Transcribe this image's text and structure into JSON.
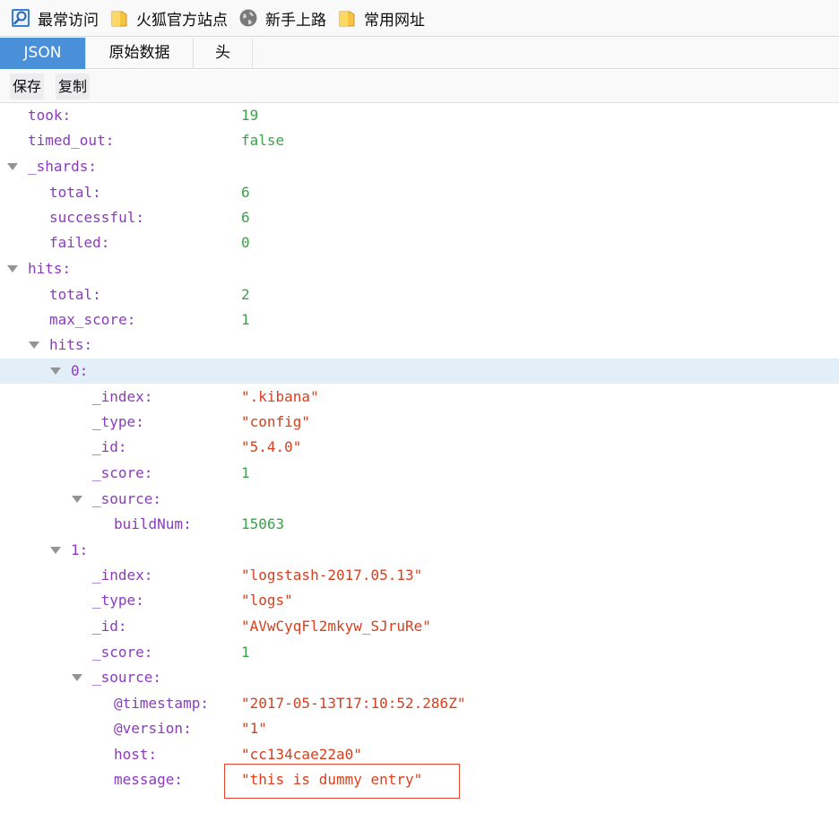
{
  "bookmarks": [
    {
      "label": "最常访问",
      "icon": "most-visited-icon"
    },
    {
      "label": "火狐官方站点",
      "icon": "folder-icon"
    },
    {
      "label": "新手上路",
      "icon": "globe-icon"
    },
    {
      "label": "常用网址",
      "icon": "folder-icon"
    }
  ],
  "tabs": [
    {
      "label": "JSON",
      "selected": true
    },
    {
      "label": "原始数据",
      "selected": false
    },
    {
      "label": "头",
      "selected": false
    }
  ],
  "actions": {
    "save": "保存",
    "copy": "复制"
  },
  "colors": {
    "selected_tab": "#4a90d9",
    "key": "#8b3bbe",
    "number": "#3ca24a",
    "string": "#d7401e",
    "selected_row": "#e3eff8",
    "highlight_box": "#e8442c"
  },
  "rows": [
    {
      "key": "took:",
      "value": "19",
      "type": "num"
    },
    {
      "key": "timed_out:",
      "value": "false",
      "type": "bool"
    },
    {
      "key": "_shards:",
      "expanded": true
    },
    {
      "key": "total:",
      "value": "6",
      "type": "num"
    },
    {
      "key": "successful:",
      "value": "6",
      "type": "num"
    },
    {
      "key": "failed:",
      "value": "0",
      "type": "num"
    },
    {
      "key": "hits:",
      "expanded": true
    },
    {
      "key": "total:",
      "value": "2",
      "type": "num"
    },
    {
      "key": "max_score:",
      "value": "1",
      "type": "num"
    },
    {
      "key": "hits:",
      "expanded": true
    },
    {
      "key": "0:",
      "expanded": true,
      "selected": true
    },
    {
      "key": "_index:",
      "value": "\".kibana\"",
      "type": "str"
    },
    {
      "key": "_type:",
      "value": "\"config\"",
      "type": "str"
    },
    {
      "key": "_id:",
      "value": "\"5.4.0\"",
      "type": "str"
    },
    {
      "key": "_score:",
      "value": "1",
      "type": "num"
    },
    {
      "key": "_source:",
      "expanded": true
    },
    {
      "key": "buildNum:",
      "value": "15063",
      "type": "num"
    },
    {
      "key": "1:",
      "expanded": true
    },
    {
      "key": "_index:",
      "value": "\"logstash-2017.05.13\"",
      "type": "str"
    },
    {
      "key": "_type:",
      "value": "\"logs\"",
      "type": "str"
    },
    {
      "key": "_id:",
      "value": "\"AVwCyqFl2mkyw_SJruRe\"",
      "type": "str"
    },
    {
      "key": "_score:",
      "value": "1",
      "type": "num"
    },
    {
      "key": "_source:",
      "expanded": true
    },
    {
      "key": "@timestamp:",
      "value": "\"2017-05-13T17:10:52.286Z\"",
      "type": "str"
    },
    {
      "key": "@version:",
      "value": "\"1\"",
      "type": "str"
    },
    {
      "key": "host:",
      "value": "\"cc134cae22a0\"",
      "type": "str"
    },
    {
      "key": "message:",
      "value": "\"this is dummy entry\"",
      "type": "str",
      "highlighted": true
    }
  ]
}
